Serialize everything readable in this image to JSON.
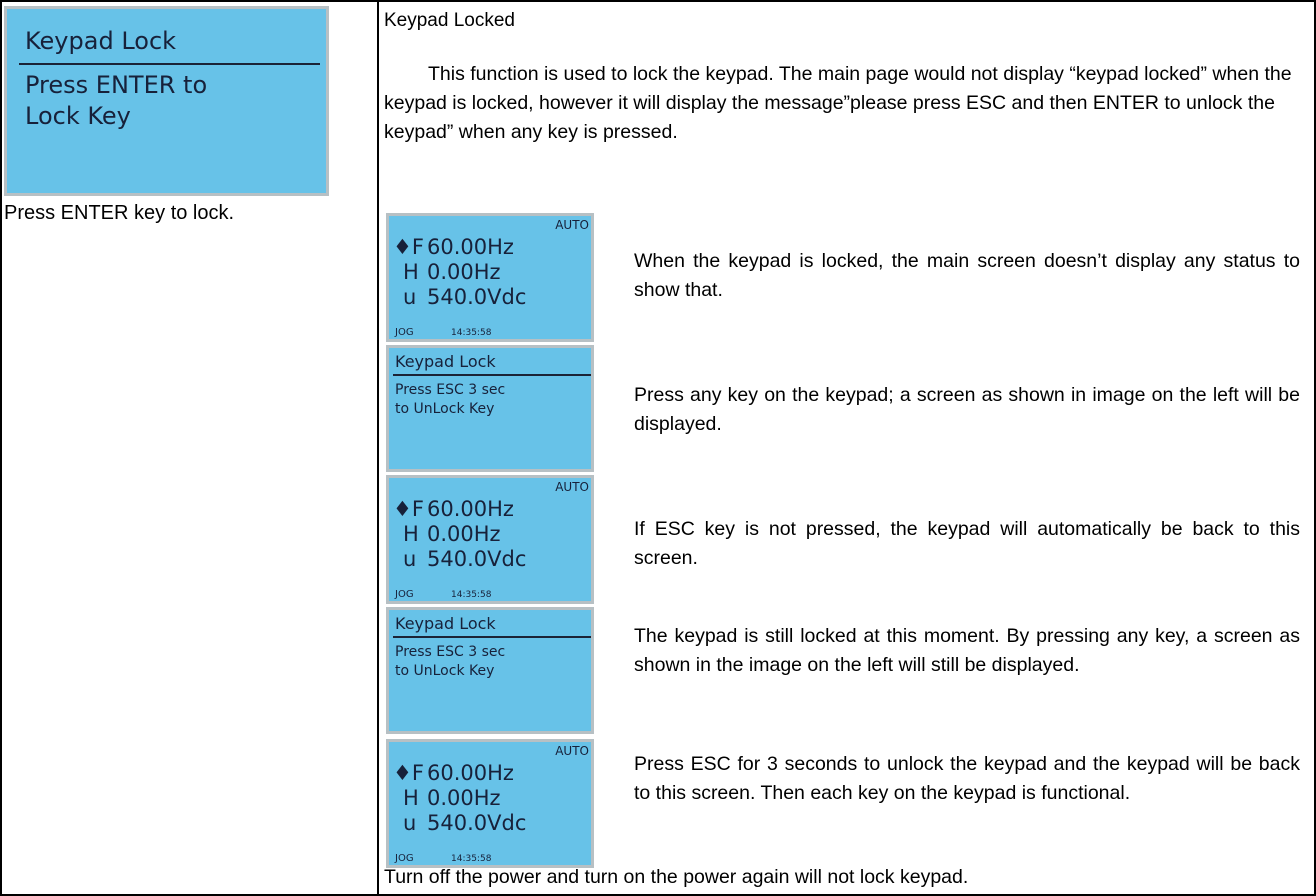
{
  "left": {
    "screen": {
      "title": "Keypad Lock",
      "line1": "Press ENTER to",
      "line2": "Lock Key"
    },
    "caption": "Press ENTER key to lock."
  },
  "right": {
    "heading": "Keypad Locked",
    "intro": "This function is used to lock the keypad. The main page would not display “keypad locked” when the keypad is locked, however it will display the message”please press ESC and then ENTER to unlock the keypad” when any key is pressed.",
    "status_screen": {
      "mode": "AUTO",
      "f_label": "♦F",
      "f_value": "60.00Hz",
      "h_label": "H",
      "h_value": "0.00Hz",
      "u_label": "u",
      "u_value": "540.0Vdc",
      "jog": "JOG",
      "time": "14:35:58"
    },
    "lock_screen": {
      "title": "Keypad Lock",
      "line1": "Press ESC 3 sec",
      "line2": "to UnLock Key"
    },
    "steps": [
      "When the keypad is locked, the main screen doesn’t display any status to show that.",
      "Press any key on the keypad; a screen as shown in image on the left will be displayed.",
      "If ESC key is not pressed, the keypad will automatically be back to this screen.",
      "The keypad is still locked at this moment. By pressing any key, a screen as shown in the image on the left will still be displayed.",
      "Press ESC for 3 seconds to unlock the keypad and the keypad will be back to this screen. Then each key on the keypad is functional."
    ],
    "footer": "Turn off the power and turn on the power again will not lock keypad."
  }
}
